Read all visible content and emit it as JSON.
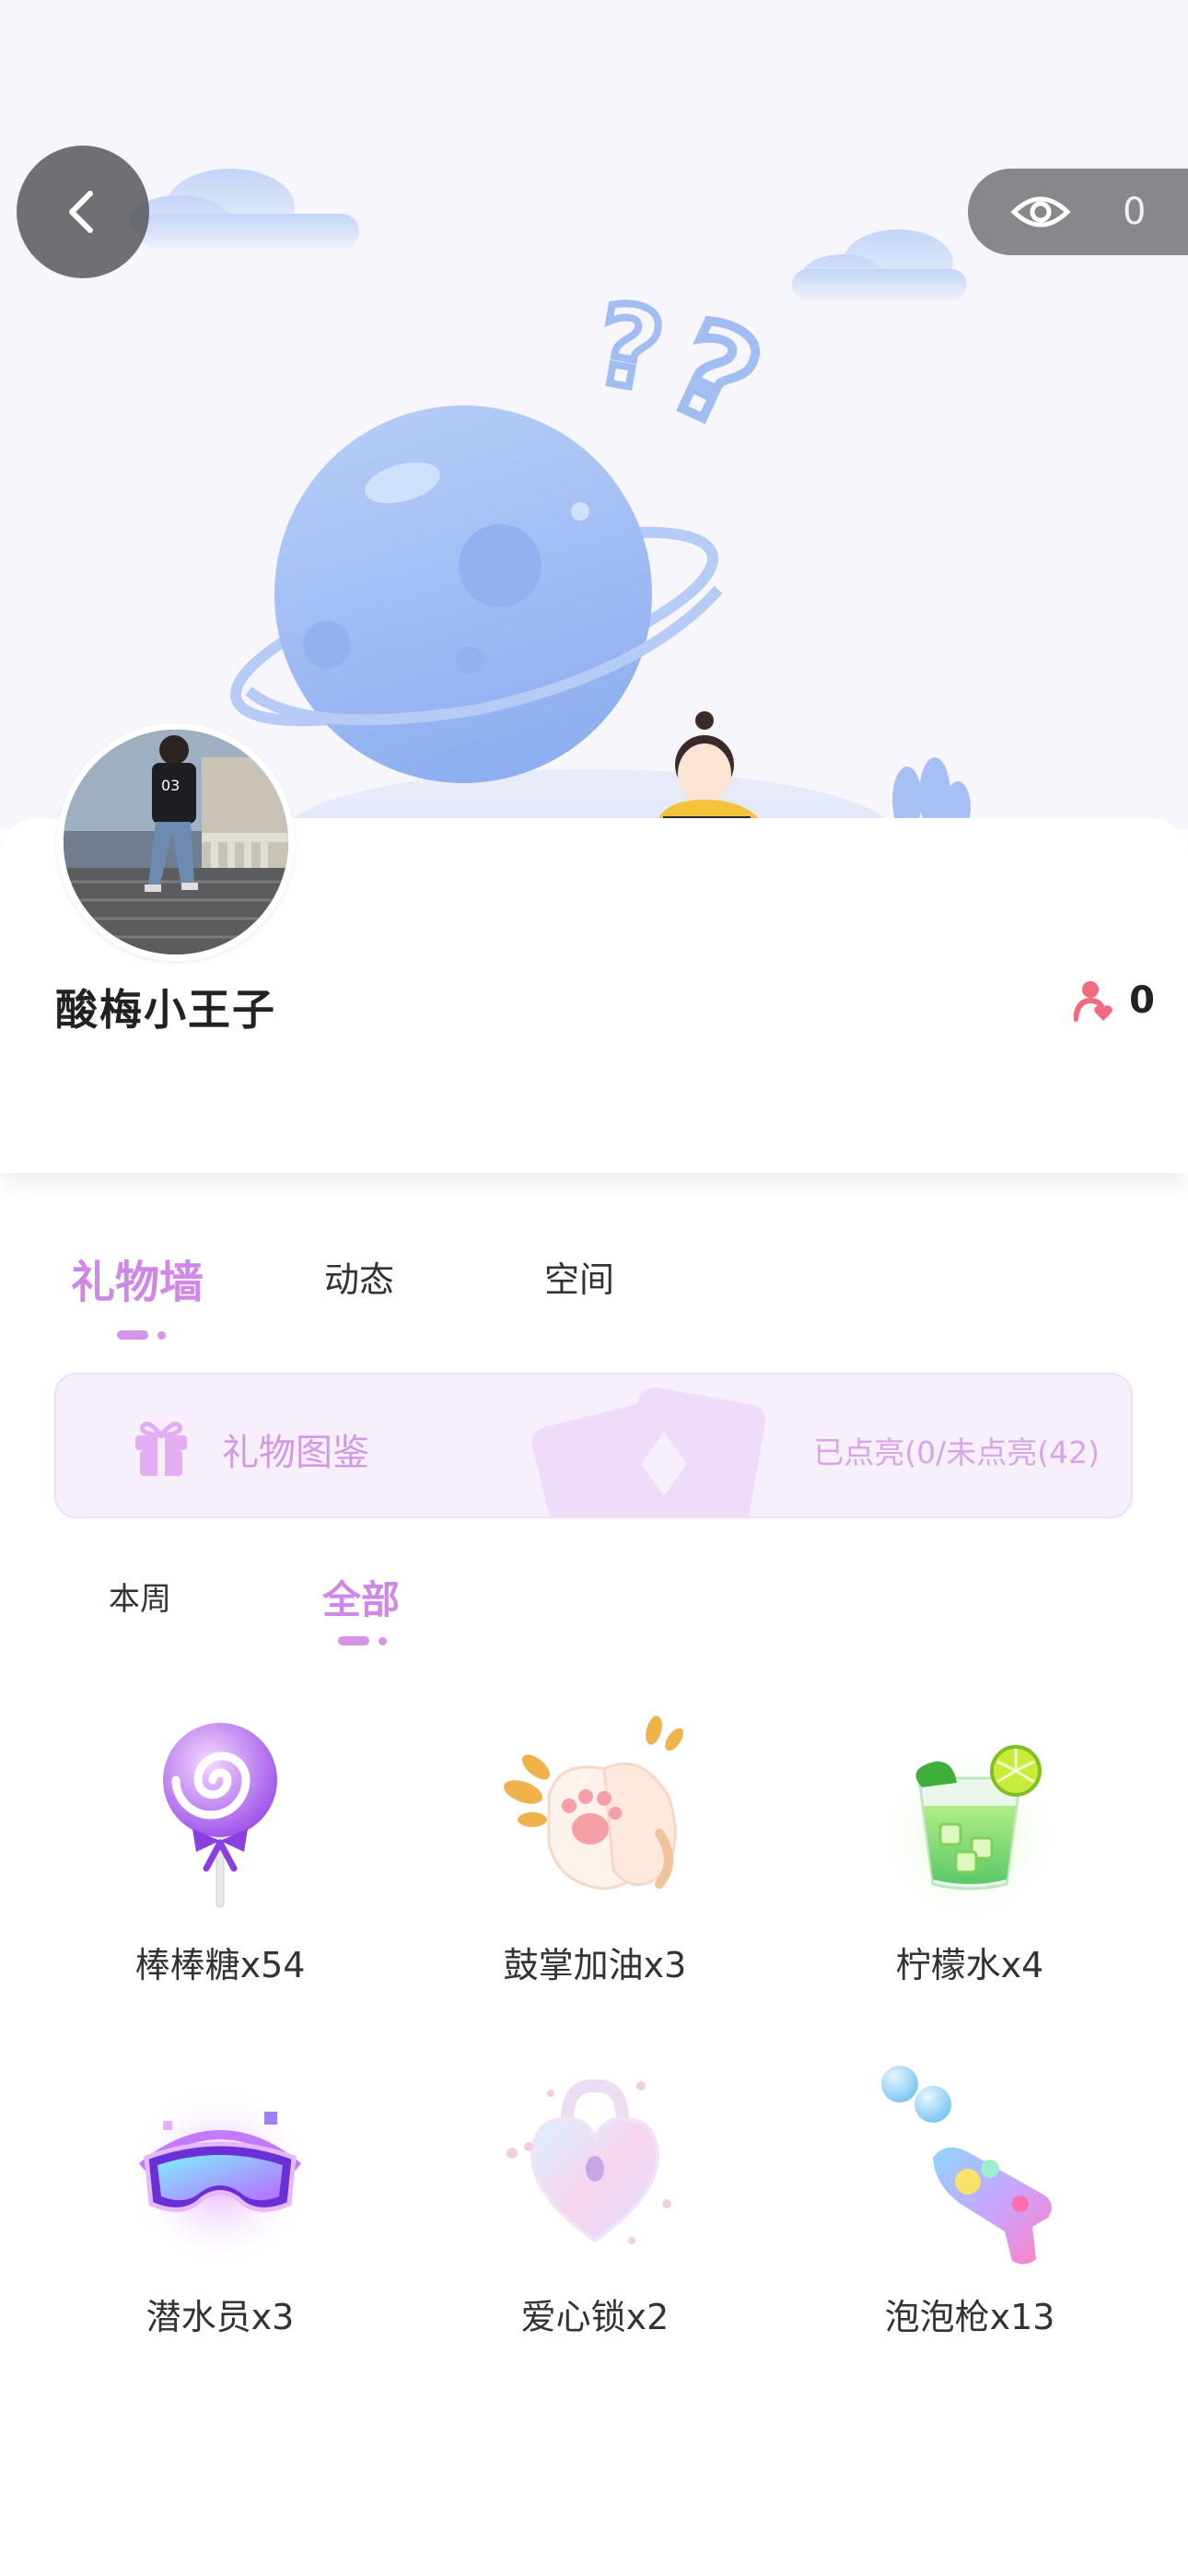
{
  "header": {
    "view_count": "0",
    "colors": {
      "hero_bg": "#f7f6fc",
      "planet": "#a9c2f5",
      "accent": "#d088e6"
    }
  },
  "profile": {
    "username": "酸梅小王子",
    "fans_count": "0"
  },
  "tabs": [
    {
      "label": "礼物墙",
      "active": true
    },
    {
      "label": "动态",
      "active": false
    },
    {
      "label": "空间",
      "active": false
    }
  ],
  "gift_banner": {
    "label": "礼物图鉴",
    "status": "已点亮(0/未点亮(42)"
  },
  "sub_tabs": [
    {
      "label": "本周",
      "active": false
    },
    {
      "label": "全部",
      "active": true
    }
  ],
  "gifts": [
    {
      "name": "棒棒糖x54",
      "icon": "lollipop-icon"
    },
    {
      "name": "鼓掌加油x3",
      "icon": "clapping-paw-icon"
    },
    {
      "name": "柠檬水x4",
      "icon": "lemonade-icon"
    },
    {
      "name": "潜水员x3",
      "icon": "diving-goggles-icon"
    },
    {
      "name": "爱心锁x2",
      "icon": "heart-lock-icon"
    },
    {
      "name": "泡泡枪x13",
      "icon": "bubble-gun-icon"
    }
  ]
}
